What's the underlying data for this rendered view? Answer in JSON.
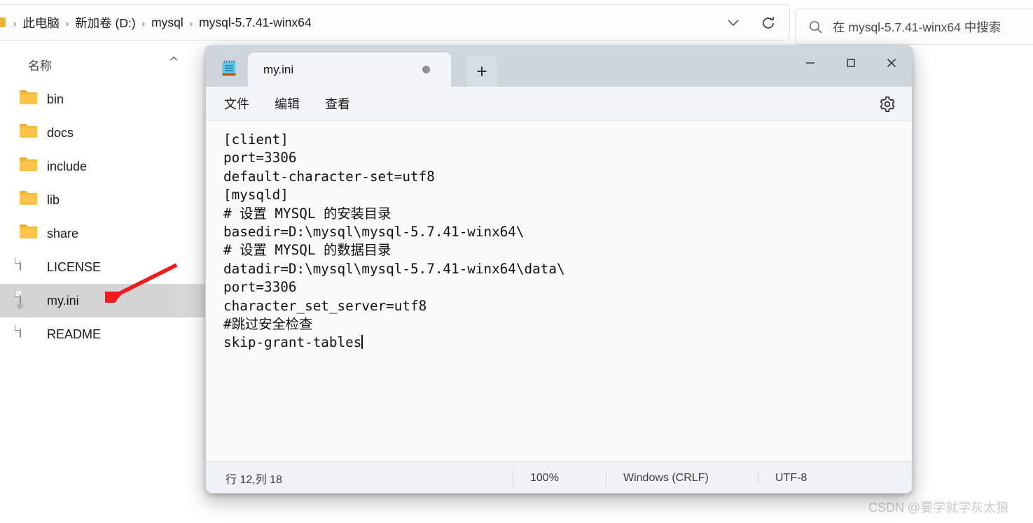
{
  "explorer": {
    "breadcrumb": {
      "separator": "›",
      "items": [
        "此电脑",
        "新加卷 (D:)",
        "mysql",
        "mysql-5.7.41-winx64"
      ]
    },
    "nav": {
      "chevron_down": "chevron-down",
      "refresh": "refresh"
    },
    "search": {
      "placeholder": "在 mysql-5.7.41-winx64 中搜索"
    },
    "column_header": {
      "name": "名称",
      "sort_indicator": "ascending"
    },
    "files": [
      {
        "name": "bin",
        "type": "folder",
        "selected": false
      },
      {
        "name": "docs",
        "type": "folder",
        "selected": false
      },
      {
        "name": "include",
        "type": "folder",
        "selected": false
      },
      {
        "name": "lib",
        "type": "folder",
        "selected": false
      },
      {
        "name": "share",
        "type": "folder",
        "selected": false
      },
      {
        "name": "LICENSE",
        "type": "document",
        "selected": false
      },
      {
        "name": "my.ini",
        "type": "ini",
        "selected": true
      },
      {
        "name": "README",
        "type": "document",
        "selected": false
      }
    ],
    "annotation": {
      "arrow_color": "#ee1c1c",
      "points_to": "my.ini"
    }
  },
  "notepad": {
    "app_icon": "notepad-icon",
    "tab": {
      "title": "my.ini",
      "unsaved": true
    },
    "new_tab_label": "+",
    "window_controls": {
      "minimize": "—",
      "maximize": "□",
      "close": "✕"
    },
    "menu": [
      "文件",
      "编辑",
      "查看"
    ],
    "settings_icon": "gear-icon",
    "content": "[client]\nport=3306\ndefault-character-set=utf8\n[mysqld]\n# 设置 MYSQL 的安装目录\nbasedir=D:\\mysql\\mysql-5.7.41-winx64\\\n# 设置 MYSQL 的数据目录\ndatadir=D:\\mysql\\mysql-5.7.41-winx64\\data\\\nport=3306\ncharacter_set_server=utf8\n#跳过安全检查\nskip-grant-tables",
    "status": {
      "position": "行 12,列 18",
      "zoom": "100%",
      "line_ending": "Windows (CRLF)",
      "encoding": "UTF-8"
    }
  },
  "watermark": "CSDN @要学就学灰太狼",
  "colors": {
    "accent_folder": "#fbc54c",
    "selection": "#d4d4d4",
    "arrow": "#ee1c1c",
    "titlebar": "#ced5dc",
    "editor_bg": "#fafafa"
  }
}
